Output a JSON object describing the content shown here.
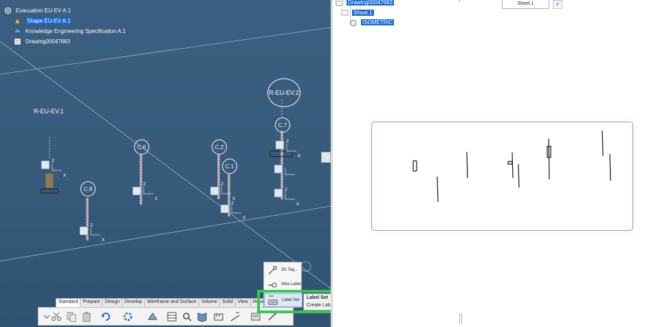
{
  "tree": {
    "root": "Evacuation EU-EV A.1",
    "items": [
      {
        "label": "Shape EU-EV A.1",
        "selected": true
      },
      {
        "label": "Knowledge Engineering Specification A.1",
        "selected": false
      },
      {
        "label": "Drawing00047683",
        "selected": false
      }
    ]
  },
  "scene": {
    "station_labels": [
      "R-EU-EV.1",
      "R-EU-EV.2"
    ],
    "circle_labels": [
      "C.8",
      "C.6",
      "C.2",
      "C.1",
      "C.7",
      "C.8"
    ],
    "axis_z": "Z",
    "axis_x": "X"
  },
  "toolbar": {
    "tabs": [
      "Standard",
      "Prepare",
      "Design",
      "Develop",
      "Wireframe and Surface",
      "Volume",
      "Solid",
      "View",
      "Review"
    ],
    "active_tab": "Standard"
  },
  "flyout": {
    "items": [
      "3D Tag...",
      "Wire Label",
      "Label Set"
    ],
    "label_set_icon_text": "Abc"
  },
  "tooltip": {
    "title": "Label Set",
    "description": "Create Label Set"
  },
  "drawing": {
    "tree": {
      "drawing": "Drawing00047683",
      "sheet": "Sheet.1",
      "view": "ISOMETRIC"
    },
    "sheet_tab": "Sheet.1",
    "add_sheet": "+"
  },
  "colors": {
    "viewport_bg": "#375a7b",
    "selection": "#1667d9",
    "highlight_box": "#35c94a",
    "sheet_frame": "#d77a7a"
  }
}
